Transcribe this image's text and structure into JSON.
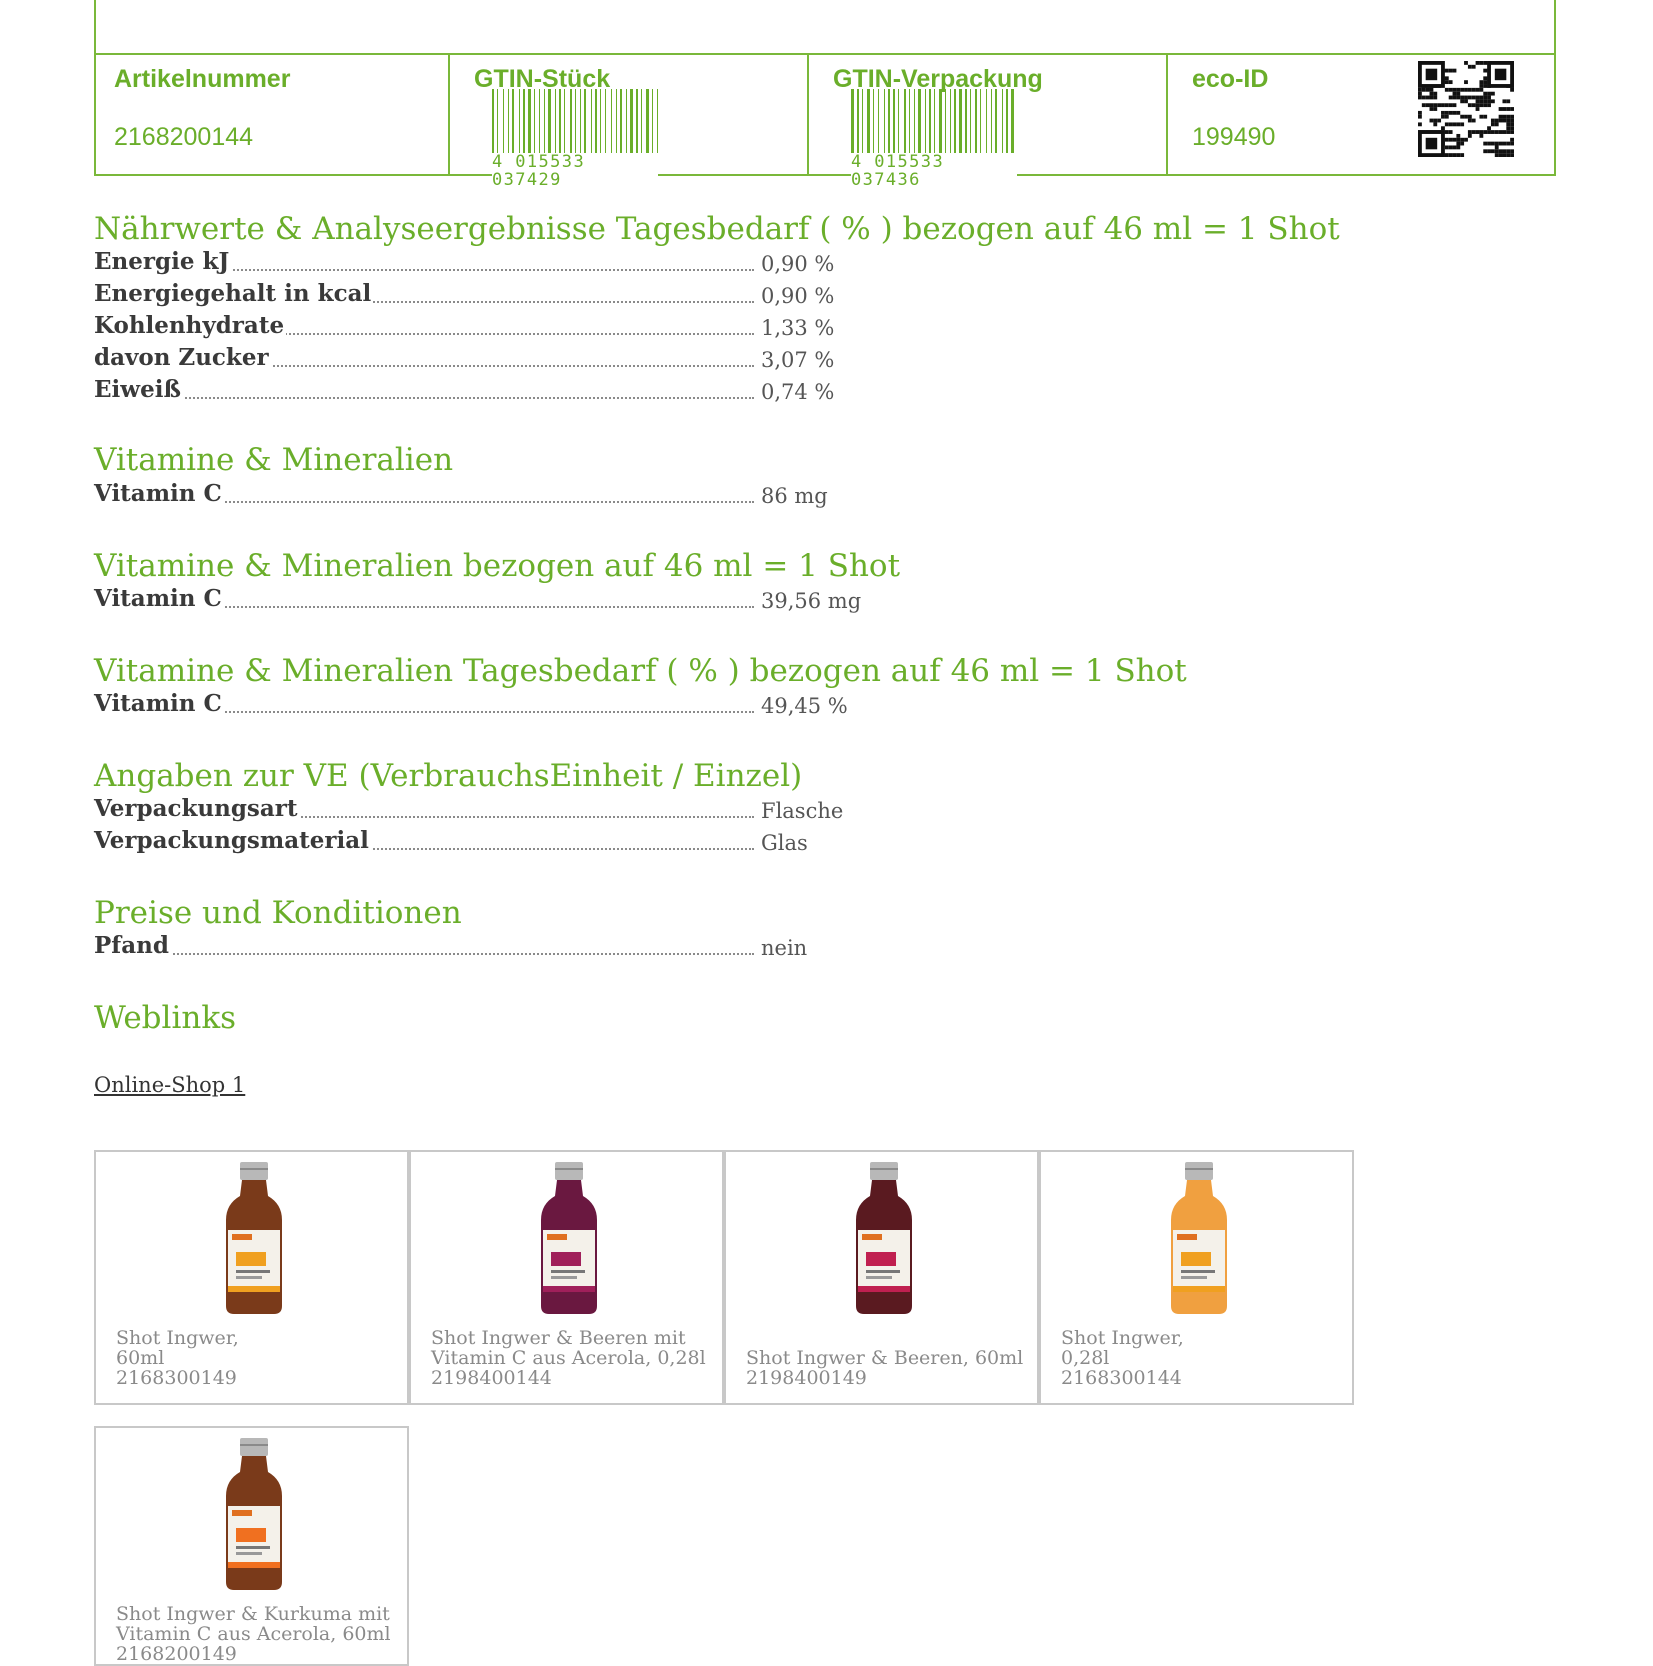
{
  "header": {
    "artikelnummer_label": "Artikelnummer",
    "artikelnummer_value": "2168200144",
    "gtin_stueck_label": "GTIN-Stück",
    "gtin_stueck_digits": "4 015533 037429",
    "gtin_verpackung_label": "GTIN-Verpackung",
    "gtin_verpackung_digits": "4 015533 037436",
    "eco_id_label": "eco-ID",
    "eco_id_value": "199490"
  },
  "sections": {
    "naehrwerte": {
      "title": "Nährwerte & Analyseergebnisse Tagesbedarf ( % ) bezogen auf 46 ml = 1 Shot",
      "rows": [
        {
          "label": "Energie kJ",
          "value": "0,90 %"
        },
        {
          "label": "Energiegehalt in kcal",
          "value": "0,90 %"
        },
        {
          "label": "Kohlenhydrate",
          "value": "1,33 %"
        },
        {
          "label": "davon Zucker",
          "value": "3,07 %"
        },
        {
          "label": "Eiweiß",
          "value": "0,74 %"
        }
      ]
    },
    "vitamine": {
      "title": "Vitamine & Mineralien",
      "rows": [
        {
          "label": "Vitamin C",
          "value": "86 mg"
        }
      ]
    },
    "vitamine_shot": {
      "title": "Vitamine & Mineralien bezogen auf 46 ml = 1 Shot",
      "rows": [
        {
          "label": "Vitamin C",
          "value": "39,56 mg"
        }
      ]
    },
    "vitamine_tagesbedarf": {
      "title": "Vitamine & Mineralien Tagesbedarf ( % ) bezogen auf 46 ml = 1 Shot",
      "rows": [
        {
          "label": "Vitamin C",
          "value": "49,45 %"
        }
      ]
    },
    "ve": {
      "title": "Angaben zur VE (VerbrauchsEinheit / Einzel)",
      "rows": [
        {
          "label": "Verpackungsart",
          "value": "Flasche"
        },
        {
          "label": "Verpackungsmaterial",
          "value": "Glas"
        }
      ]
    },
    "preise": {
      "title": "Preise und Konditionen",
      "rows": [
        {
          "label": "Pfand",
          "value": "nein"
        }
      ]
    },
    "weblinks": {
      "title": "Weblinks",
      "link": "Online-Shop 1"
    }
  },
  "products": [
    {
      "name": "Shot Ingwer,\n60ml\n2168300149",
      "bottle": "shot-ingwer",
      "liquid": "#7a3a1a",
      "label_color": "#f0a020"
    },
    {
      "name": "Shot Ingwer & Beeren mit\nVitamin C aus Acerola, 0,28l\n2198400144",
      "bottle": "shot-beeren-large",
      "liquid": "#6a1840",
      "label_color": "#a0205a"
    },
    {
      "name": "\nShot Ingwer & Beeren, 60ml\n2198400149",
      "bottle": "shot-beeren",
      "liquid": "#5a1a20",
      "label_color": "#c02050"
    },
    {
      "name": "Shot Ingwer,\n0,28l\n2168300144",
      "bottle": "shot-ingwer-large",
      "liquid": "#f0a040",
      "label_color": "#f0a020"
    },
    {
      "name": "Shot Ingwer & Kurkuma mit\nVitamin C aus Acerola, 60ml\n2168200149",
      "bottle": "shot-kurkuma",
      "liquid": "#7a3a1a",
      "label_color": "#f07020"
    }
  ],
  "colors": {
    "accent": "#6aae2a",
    "border": "#7ab83a",
    "card_border": "#c8c8c8"
  }
}
